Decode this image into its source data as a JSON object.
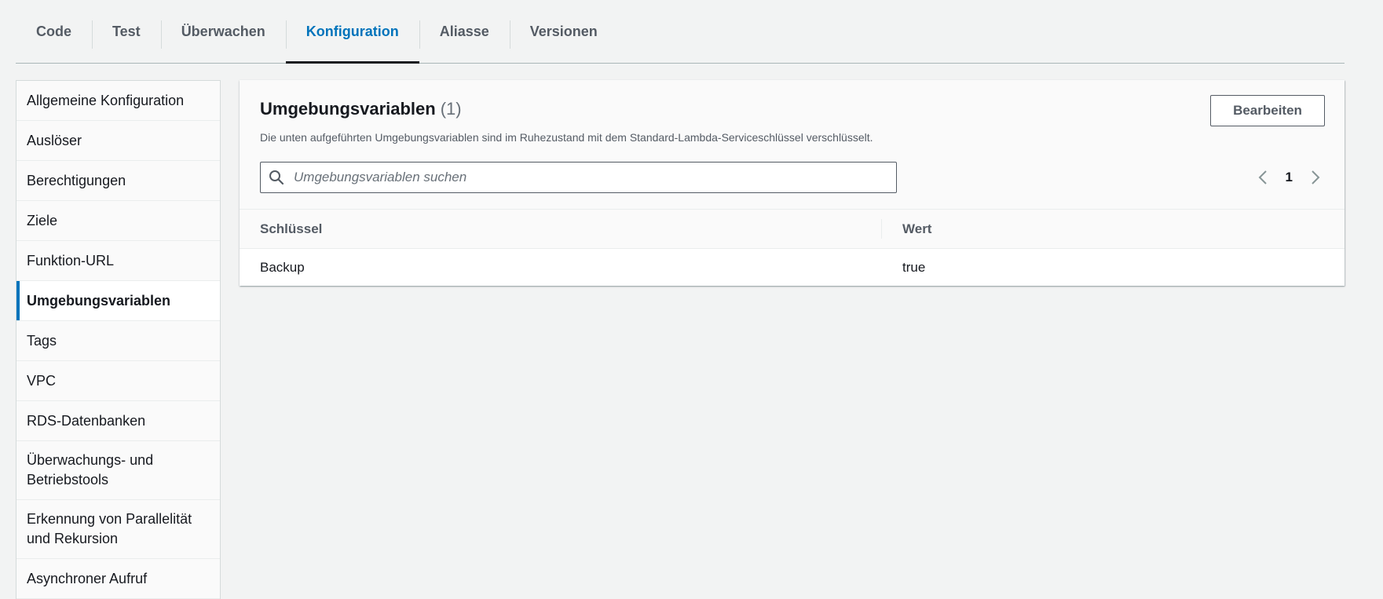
{
  "tabs": [
    {
      "label": "Code"
    },
    {
      "label": "Test"
    },
    {
      "label": "Überwachen"
    },
    {
      "label": "Konfiguration",
      "active": true
    },
    {
      "label": "Aliasse"
    },
    {
      "label": "Versionen"
    }
  ],
  "sidebar": {
    "items": [
      {
        "label": "Allgemeine Konfiguration"
      },
      {
        "label": "Auslöser"
      },
      {
        "label": "Berechtigungen"
      },
      {
        "label": "Ziele"
      },
      {
        "label": "Funktion-URL"
      },
      {
        "label": "Umgebungsvariablen",
        "active": true
      },
      {
        "label": "Tags"
      },
      {
        "label": "VPC"
      },
      {
        "label": "RDS-Datenbanken"
      },
      {
        "label": "Überwachungs- und Betriebstools"
      },
      {
        "label": "Erkennung von Parallelität und Rekursion"
      },
      {
        "label": "Asynchroner Aufruf"
      }
    ]
  },
  "panel": {
    "title": "Umgebungsvariablen",
    "count": "(1)",
    "description": "Die unten aufgeführten Umgebungsvariablen sind im Ruhezustand mit dem Standard-Lambda-Serviceschlüssel verschlüsselt.",
    "edit_label": "Bearbeiten",
    "search_placeholder": "Umgebungsvariablen suchen",
    "search_value": "",
    "page_number": "1",
    "columns": [
      "Schlüssel",
      "Wert"
    ],
    "rows": [
      {
        "key": "Backup",
        "value": "true"
      }
    ]
  },
  "colors": {
    "accent": "#0073bb",
    "background": "#f2f3f3"
  },
  "icons": {
    "search": "search-icon",
    "prev": "chevron-left-icon",
    "next": "chevron-right-icon"
  }
}
